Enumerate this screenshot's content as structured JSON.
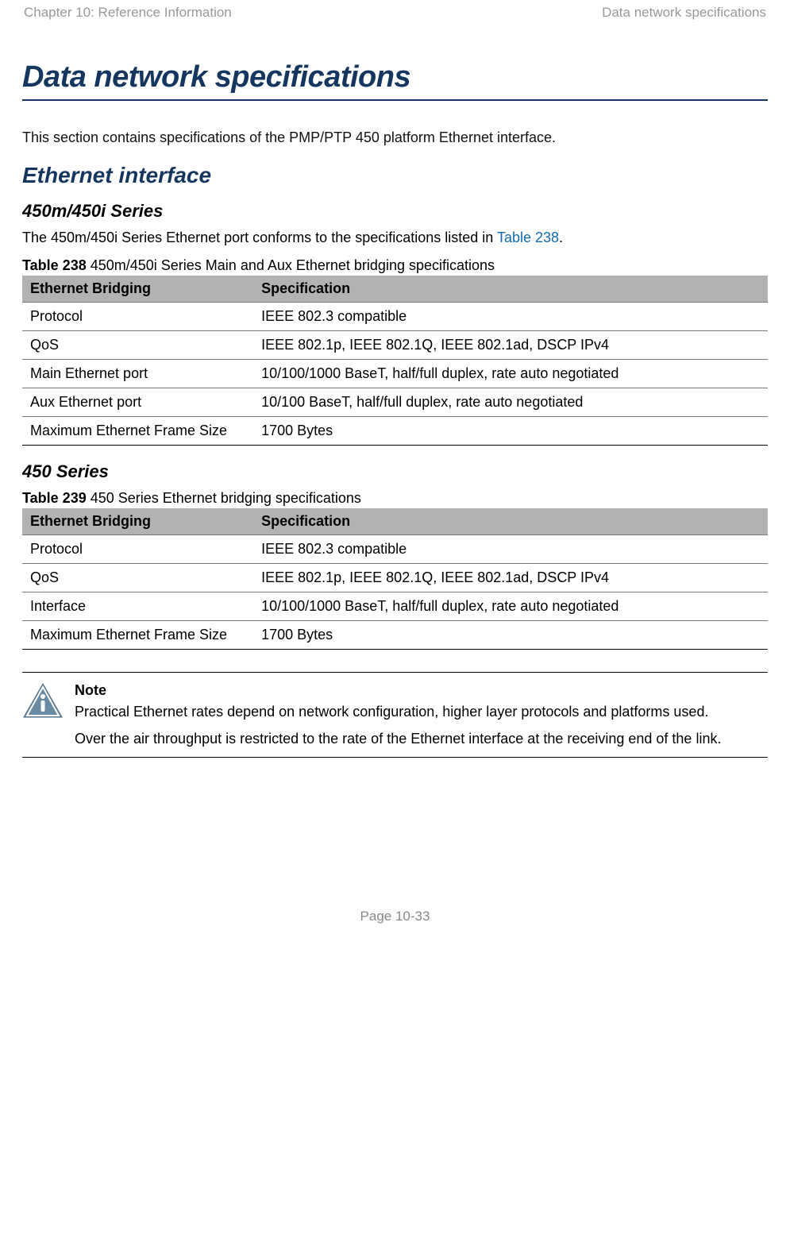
{
  "header": {
    "left": "Chapter 10:  Reference Information",
    "right": "Data network specifications"
  },
  "title": "Data network specifications",
  "intro": "This section contains specifications of the PMP/PTP 450 platform Ethernet interface.",
  "section_ethernet": "Ethernet interface",
  "sub_450m": "450m/450i Series",
  "sub_450m_intro_pre": "The 450m/450i Series Ethernet port conforms to the specifications listed in ",
  "sub_450m_intro_link": "Table 238",
  "sub_450m_intro_post": ".",
  "table238": {
    "label": "Table 238",
    "caption": " 450m/450i Series Main and Aux Ethernet bridging specifications",
    "head": [
      "Ethernet Bridging",
      "Specification"
    ],
    "rows": [
      [
        "Protocol",
        "IEEE 802.3 compatible"
      ],
      [
        "QoS",
        "IEEE 802.1p, IEEE 802.1Q, IEEE 802.1ad, DSCP IPv4"
      ],
      [
        "Main Ethernet port",
        "10/100/1000 BaseT, half/full duplex, rate auto negotiated"
      ],
      [
        "Aux Ethernet port",
        "10/100 BaseT, half/full duplex, rate auto negotiated"
      ],
      [
        "Maximum Ethernet Frame Size",
        "1700 Bytes"
      ]
    ]
  },
  "sub_450": "450 Series",
  "table239": {
    "label": "Table 239",
    "caption": " 450 Series Ethernet bridging specifications",
    "head": [
      "Ethernet Bridging",
      "Specification"
    ],
    "rows": [
      [
        "Protocol",
        "IEEE 802.3 compatible"
      ],
      [
        "QoS",
        "IEEE 802.1p, IEEE 802.1Q, IEEE 802.1ad, DSCP IPv4"
      ],
      [
        "Interface",
        "10/100/1000 BaseT, half/full duplex, rate auto negotiated"
      ],
      [
        "Maximum Ethernet Frame Size",
        "1700 Bytes"
      ]
    ]
  },
  "note": {
    "title": "Note",
    "p1": "Practical Ethernet rates depend on network configuration, higher layer protocols and platforms used.",
    "p2": "Over the air throughput is restricted to the rate of the Ethernet interface at the receiving end of the link."
  },
  "footer": "Page 10-33"
}
